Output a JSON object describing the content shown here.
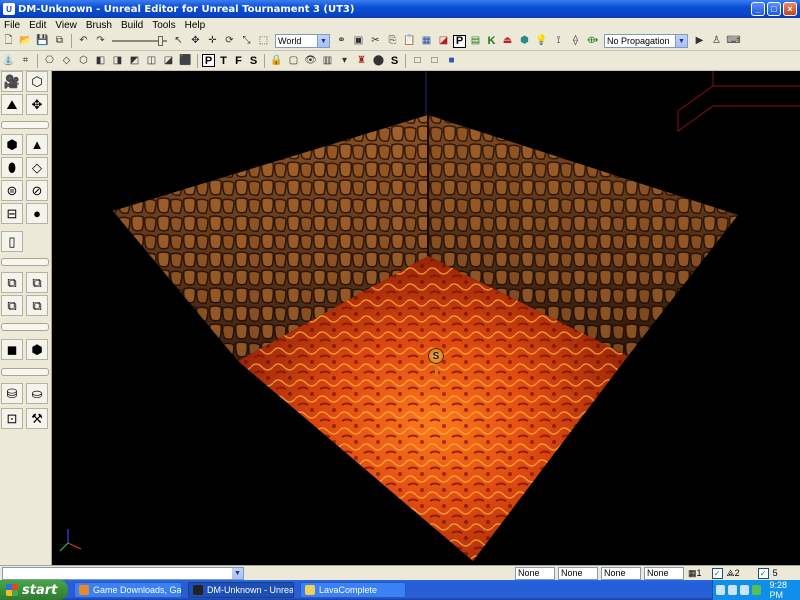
{
  "window": {
    "title": "DM-Unknown - Unreal Editor for Unreal Tournament 3 (UT3)",
    "minimize_glyph": "_",
    "maximize_glyph": "□",
    "close_glyph": "×"
  },
  "menu": [
    "File",
    "Edit",
    "View",
    "Brush",
    "Build",
    "Tools",
    "Help"
  ],
  "toolbar": {
    "coordinate_system": "World",
    "propagation": "No Propagation",
    "dropdown_arrow": "▼",
    "prefab_letter": "P",
    "kismet_letter": "K"
  },
  "toolbar2": {
    "letters": [
      "P",
      "T",
      "F",
      "S"
    ],
    "show_letter": "S"
  },
  "viewport": {
    "spawn_label": "S"
  },
  "statusbar": {
    "command_value": "",
    "fields": [
      "None",
      "None",
      "None",
      "None"
    ],
    "grid_count": "1",
    "rot_count": "2",
    "scale_count": "5"
  },
  "taskbar": {
    "start_label": "start",
    "items": [
      "Game Downloads, Ga...",
      "DM-Unknown - Unreal...",
      "LavaComplete"
    ],
    "clock": "9:28 PM"
  },
  "colors": {
    "titlebar": "#0a4fd6",
    "chrome": "#ece9d8",
    "lava": "#d4460f",
    "stone": "#6a3e1c"
  }
}
